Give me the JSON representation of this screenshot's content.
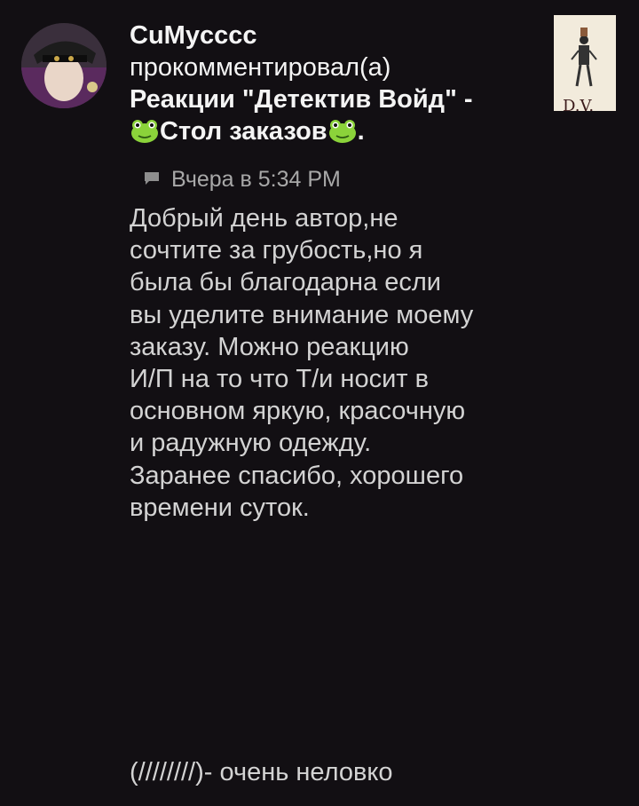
{
  "notification": {
    "username": "CuMycccc",
    "action": "прокомментировал(а)",
    "post_title": "Реакции \"Детектив Войд\" -",
    "post_title_line2": "Стол заказов",
    "post_title_suffix": ".",
    "icons": [
      "avatar-photo",
      "frog-emoji",
      "post-thumbnail",
      "comment-icon"
    ],
    "thumbnail_text": "D.V."
  },
  "meta": {
    "timestamp": "Вчера в 5:34 PM"
  },
  "comment": {
    "body": "Добрый день автор,не\nсочтите за грубость,но я\nбыла бы благодарна если\nвы уделите внимание моему\nзаказу. Можно реакцию\nИ/П на то что Т/и носит в\nосновном яркую, красочную\nи радужную одежду.\nЗаранее спасибо, хорошего\nвремени суток."
  },
  "footer": {
    "text": "(////////)- очень неловко"
  },
  "colors": {
    "background": "#120f13",
    "title_text": "#f4f4f4",
    "body_text": "#d3d3d3",
    "meta_text": "#a8a8a8",
    "frog_green": "#8bd33a"
  }
}
